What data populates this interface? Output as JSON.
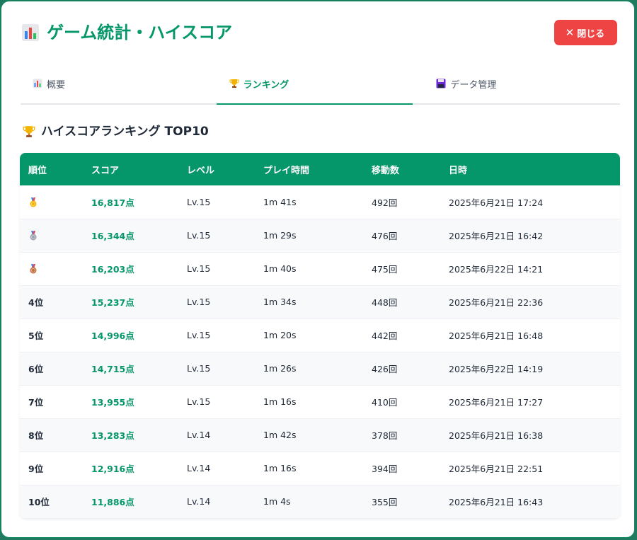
{
  "header": {
    "title": "ゲーム統計・ハイスコア",
    "title_icon": "bar-chart-icon",
    "close_label": "閉じる",
    "close_icon": "close-icon"
  },
  "tabs": [
    {
      "label": "概要",
      "icon": "bar-chart-icon",
      "active": false
    },
    {
      "label": "ランキング",
      "icon": "trophy-icon",
      "active": true
    },
    {
      "label": "データ管理",
      "icon": "floppy-disk-icon",
      "active": false
    }
  ],
  "section": {
    "title": "ハイスコアランキング TOP10",
    "icon": "trophy-icon"
  },
  "table": {
    "headers": [
      "順位",
      "スコア",
      "レベル",
      "プレイ時間",
      "移動数",
      "日時"
    ],
    "rows": [
      {
        "rank": "",
        "medal": "gold-medal-icon",
        "score": "16,817点",
        "level": "Lv.15",
        "time": "1m 41s",
        "moves": "492回",
        "date": "2025年6月21日 17:24"
      },
      {
        "rank": "",
        "medal": "silver-medal-icon",
        "score": "16,344点",
        "level": "Lv.15",
        "time": "1m 29s",
        "moves": "476回",
        "date": "2025年6月21日 16:42"
      },
      {
        "rank": "",
        "medal": "bronze-medal-icon",
        "score": "16,203点",
        "level": "Lv.15",
        "time": "1m 40s",
        "moves": "475回",
        "date": "2025年6月22日 14:21"
      },
      {
        "rank": "4位",
        "medal": "",
        "score": "15,237点",
        "level": "Lv.15",
        "time": "1m 34s",
        "moves": "448回",
        "date": "2025年6月21日 22:36"
      },
      {
        "rank": "5位",
        "medal": "",
        "score": "14,996点",
        "level": "Lv.15",
        "time": "1m 20s",
        "moves": "442回",
        "date": "2025年6月21日 16:48"
      },
      {
        "rank": "6位",
        "medal": "",
        "score": "14,715点",
        "level": "Lv.15",
        "time": "1m 26s",
        "moves": "426回",
        "date": "2025年6月22日 14:19"
      },
      {
        "rank": "7位",
        "medal": "",
        "score": "13,955点",
        "level": "Lv.15",
        "time": "1m 16s",
        "moves": "410回",
        "date": "2025年6月21日 17:27"
      },
      {
        "rank": "8位",
        "medal": "",
        "score": "13,283点",
        "level": "Lv.14",
        "time": "1m 42s",
        "moves": "378回",
        "date": "2025年6月21日 16:38"
      },
      {
        "rank": "9位",
        "medal": "",
        "score": "12,916点",
        "level": "Lv.14",
        "time": "1m 16s",
        "moves": "394回",
        "date": "2025年6月21日 22:51"
      },
      {
        "rank": "10位",
        "medal": "",
        "score": "11,886点",
        "level": "Lv.14",
        "time": "1m 4s",
        "moves": "355回",
        "date": "2025年6月21日 16:43"
      }
    ]
  },
  "colors": {
    "accent": "#059669",
    "close": "#ef4444",
    "gold": "#f5b301",
    "silver": "#9ca3af",
    "bronze": "#c2703d"
  }
}
